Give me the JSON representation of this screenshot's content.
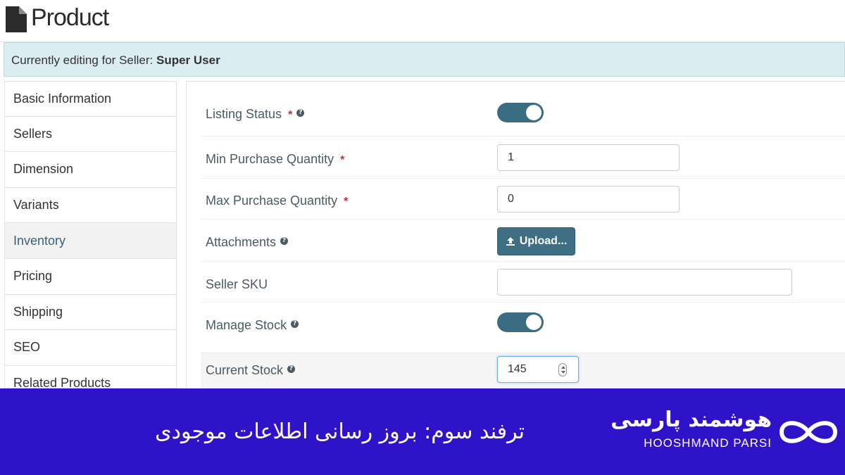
{
  "header": {
    "title": "Product",
    "icon": "document-icon"
  },
  "seller_bar": {
    "prefix": "Currently editing for Seller:",
    "seller": "Super User"
  },
  "sidebar": {
    "items": [
      {
        "label": "Basic Information",
        "active": false
      },
      {
        "label": "Sellers",
        "active": false
      },
      {
        "label": "Dimension",
        "active": false
      },
      {
        "label": "Variants",
        "active": false
      },
      {
        "label": "Inventory",
        "active": true
      },
      {
        "label": "Pricing",
        "active": false
      },
      {
        "label": "Shipping",
        "active": false
      },
      {
        "label": "SEO",
        "active": false
      },
      {
        "label": "Related Products",
        "active": false
      }
    ]
  },
  "form": {
    "listing_status": {
      "label": "Listing Status",
      "required": "*",
      "help": "?",
      "value": "on"
    },
    "min_qty": {
      "label": "Min Purchase Quantity",
      "required": "*",
      "value": "1"
    },
    "max_qty": {
      "label": "Max Purchase Quantity",
      "required": "*",
      "value": "0"
    },
    "attachments": {
      "label": "Attachments",
      "help": "?",
      "button": "Upload..."
    },
    "seller_sku": {
      "label": "Seller SKU",
      "value": ""
    },
    "manage_stock": {
      "label": "Manage Stock",
      "help": "?",
      "value": "on"
    },
    "current_stock": {
      "label": "Current Stock",
      "help": "?",
      "value": "145"
    }
  },
  "banner": {
    "caption": "ترفند سوم: بروز رسانی اطلاعات موجودی",
    "brand_fa": "هوشمند پارسی",
    "brand_en": "HOOSHMAND PARSI",
    "background": "#2f13c9"
  },
  "colors": {
    "accent": "#3a6c82",
    "required": "#c9302c",
    "seller_bar": "#d9edf2"
  }
}
